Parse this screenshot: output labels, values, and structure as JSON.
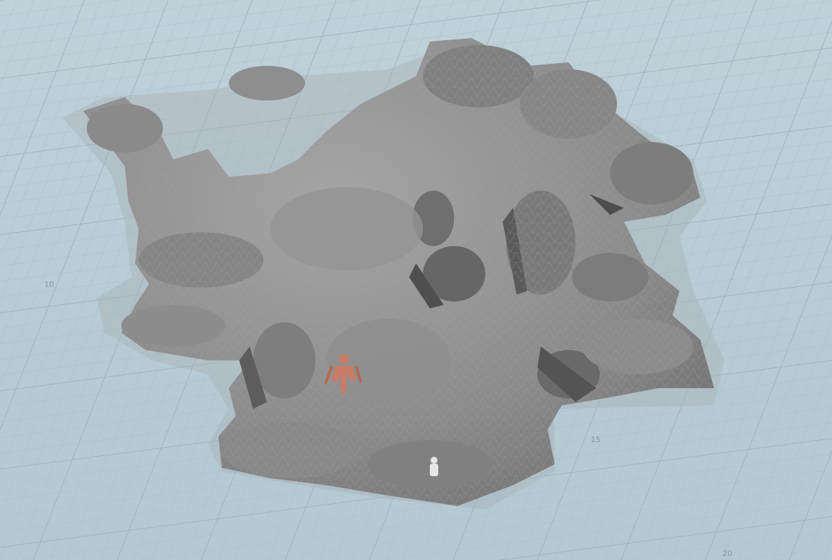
{
  "viewport": {
    "background_color": "#b6c9d3",
    "grid_color": "#9fb4c0",
    "terrain_color": "#8f8f8f",
    "terrain_shadow_color": "#5c5c5c",
    "terrain_highlight_color": "#b0b0b0",
    "character_color": "#c97c66",
    "figure_color": "#e6e6e6"
  },
  "grid_labels": {
    "label_10": "10",
    "label_15": "15",
    "label_20": "20"
  }
}
